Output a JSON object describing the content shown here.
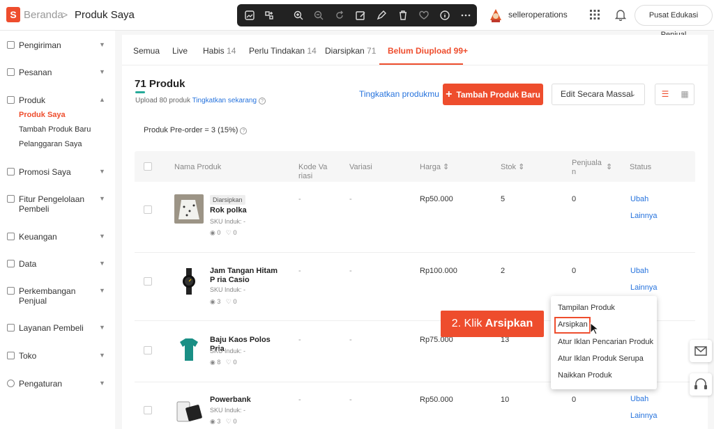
{
  "header": {
    "breadcrumb_home": "Beranda",
    "breadcrumb_sep": ">",
    "breadcrumb_current": "Produk Saya",
    "seller_name": "selleroperations",
    "edu_button": "Pusat Edukasi Penjual",
    "logo_letter": "S"
  },
  "sidebar": {
    "items": [
      {
        "label": "Pengiriman",
        "icon": "truck-icon"
      },
      {
        "label": "Pesanan",
        "icon": "clipboard-icon"
      },
      {
        "label": "Produk",
        "icon": "box-icon"
      },
      {
        "label": "Promosi Saya",
        "icon": "tag-icon"
      },
      {
        "label": "Fitur Pengelolaan Pembeli",
        "icon": "users-icon"
      },
      {
        "label": "Keuangan",
        "icon": "wallet-icon"
      },
      {
        "label": "Data",
        "icon": "chart-icon"
      },
      {
        "label": "Perkembangan Penjual",
        "icon": "growth-icon"
      },
      {
        "label": "Layanan Pembeli",
        "icon": "service-icon"
      },
      {
        "label": "Toko",
        "icon": "store-icon"
      },
      {
        "label": "Pengaturan",
        "icon": "gear-icon"
      }
    ],
    "product_sub": [
      "Produk Saya",
      "Tambah Produk Baru",
      "Pelanggaran Saya"
    ]
  },
  "tabs": [
    {
      "label": "Semua",
      "count": ""
    },
    {
      "label": "Live",
      "count": ""
    },
    {
      "label": "Habis",
      "count": "14"
    },
    {
      "label": "Perlu Tindakan",
      "count": "14"
    },
    {
      "label": "Diarsipkan",
      "count": "71"
    },
    {
      "label": "Belum Diupload 99+",
      "count": ""
    }
  ],
  "summary": {
    "title": "71 Produk",
    "upload_text": "Upload 80 produk",
    "upload_link": "Tingkatkan sekarang",
    "upload_progress": 0.11,
    "improve_link": "Tingkatkan produkmu",
    "add_button": "Tambah Produk Baru",
    "add_plus": "+",
    "mass_edit": "Edit Secara Massal",
    "preorder": "Produk Pre-order = 3 (15%)",
    "help": "?"
  },
  "table": {
    "headers": [
      "Nama Produk",
      "Kode Va riasi",
      "Variasi",
      "Harga",
      "Stok",
      "Penjuala n",
      "Status"
    ],
    "rows": [
      {
        "badge": "Diarsipkan",
        "name": "Rok polka",
        "sku": "SKU Induk: -",
        "views": "0",
        "likes": "0",
        "code": "-",
        "variant": "-",
        "price": "Rp50.000",
        "stock": "5",
        "sales": "0",
        "action1": "Ubah",
        "action2": "Lainnya"
      },
      {
        "badge": "",
        "name": "Jam Tangan Hitam P ria Casio",
        "sku": "SKU Induk: -",
        "views": "3",
        "likes": "0",
        "code": "-",
        "variant": "-",
        "price": "Rp100.000",
        "stock": "2",
        "sales": "0",
        "action1": "Ubah",
        "action2": "Lainnya"
      },
      {
        "badge": "",
        "name": "Baju Kaos Polos Pria",
        "sku": "SKU Induk: -",
        "views": "8",
        "likes": "0",
        "code": "-",
        "variant": "-",
        "price": "Rp75.000",
        "stock": "13",
        "sales": "",
        "action1": "",
        "action2": ""
      },
      {
        "badge": "",
        "name": "Powerbank",
        "sku": "SKU Induk: -",
        "views": "3",
        "likes": "0",
        "code": "-",
        "variant": "-",
        "price": "Rp50.000",
        "stock": "10",
        "sales": "0",
        "action1": "Ubah",
        "action2": "Lainnya"
      }
    ]
  },
  "menu": {
    "items": [
      "Tampilan Produk",
      "Arsipkan",
      "Atur Iklan Pencarian Produk",
      "Atur Iklan Produk Serupa",
      "Naikkan Produk"
    ]
  },
  "callout": {
    "prefix": "2. Klik",
    "bold": "Arsipkan"
  },
  "colors": {
    "accent": "#ee4d2d",
    "link": "#2673dd",
    "progress": "#26aa99"
  }
}
